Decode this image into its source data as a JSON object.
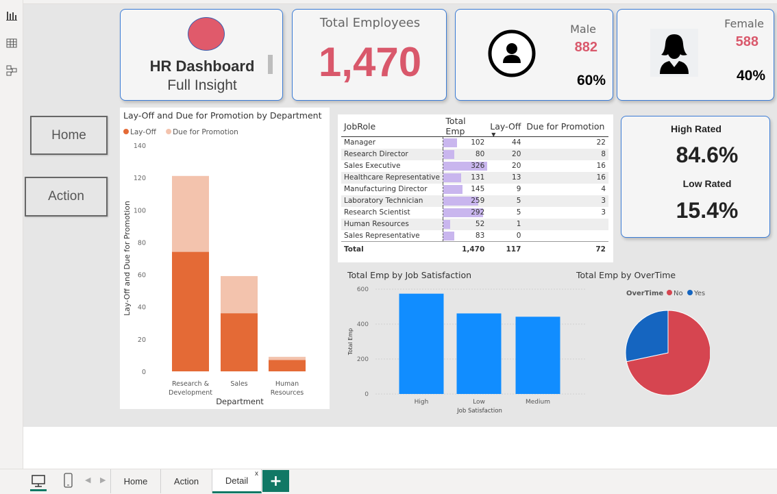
{
  "leftrail": {
    "icons": [
      "report-view-icon",
      "table-view-icon",
      "model-view-icon"
    ]
  },
  "nav": {
    "home_label": "Home",
    "action_label": "Action"
  },
  "title_card": {
    "title": "HR Dashboard",
    "subtitle": "Full Insight",
    "logo_color": "#e05a6b"
  },
  "total_card": {
    "label": "Total Employees",
    "value": "1,470"
  },
  "male_card": {
    "label": "Male",
    "count": "882",
    "percent": "60%",
    "icon": "person-circle-icon"
  },
  "female_card": {
    "label": "Female",
    "count": "588",
    "percent": "40%",
    "icon": "female-user-icon"
  },
  "rating_card": {
    "high_label": "High Rated",
    "high_value": "84.6%",
    "low_label": "Low Rated",
    "low_value": "15.4%"
  },
  "colors": {
    "accent_red": "#d9586b",
    "layoff": "#e46a36",
    "promotion": "#f3c3ad",
    "blue_bar": "#118dff",
    "pie_no": "#d64550",
    "pie_yes": "#1565c0",
    "table_bar": "#c9b6ee"
  },
  "jobrole_table": {
    "headers": [
      "JobRole",
      "Total Emp",
      "Lay-Off",
      "Due for Promotion"
    ],
    "rows": [
      {
        "role": "Manager",
        "total": "102",
        "layoff": "44",
        "promo": "22"
      },
      {
        "role": "Research Director",
        "total": "80",
        "layoff": "20",
        "promo": "8"
      },
      {
        "role": "Sales Executive",
        "total": "326",
        "layoff": "20",
        "promo": "16"
      },
      {
        "role": "Healthcare Representative",
        "total": "131",
        "layoff": "13",
        "promo": "16"
      },
      {
        "role": "Manufacturing Director",
        "total": "145",
        "layoff": "9",
        "promo": "4"
      },
      {
        "role": "Laboratory Technician",
        "total": "259",
        "layoff": "5",
        "promo": "3"
      },
      {
        "role": "Research Scientist",
        "total": "292",
        "layoff": "5",
        "promo": "3"
      },
      {
        "role": "Human Resources",
        "total": "52",
        "layoff": "1",
        "promo": ""
      },
      {
        "role": "Sales Representative",
        "total": "83",
        "layoff": "0",
        "promo": ""
      }
    ],
    "total": {
      "label": "Total",
      "total": "1,470",
      "layoff": "117",
      "promo": "72"
    },
    "bar_max": 326
  },
  "chart_data": [
    {
      "type": "bar",
      "stacked": true,
      "title": "Lay-Off and Due for Promotion by Department",
      "xlabel": "Department",
      "ylabel": "Lay-Off and Due for Promotion",
      "categories": [
        "Research & Development",
        "Sales",
        "Human Resources"
      ],
      "category_lines": [
        [
          "Research &",
          "Development"
        ],
        [
          "Sales"
        ],
        [
          "Human",
          "Resources"
        ]
      ],
      "series": [
        {
          "name": "Lay-Off",
          "values": [
            74,
            36,
            7
          ]
        },
        {
          "name": "Due for Promotion",
          "values": [
            47,
            23,
            2
          ]
        }
      ],
      "ylim": [
        0,
        140
      ],
      "yticks": [
        0,
        20,
        40,
        60,
        80,
        100,
        120,
        140
      ],
      "legend": "top-left",
      "grid": false
    },
    {
      "type": "bar",
      "title": "Total Emp by Job Satisfaction",
      "xlabel": "Job Satisfaction",
      "ylabel": "Total Emp",
      "categories": [
        "High",
        "Low",
        "Medium"
      ],
      "values": [
        574,
        461,
        442
      ],
      "ylim": [
        0,
        600
      ],
      "yticks": [
        0,
        200,
        400,
        600
      ],
      "grid": true
    },
    {
      "type": "pie",
      "title": "Total Emp by OverTime",
      "legend_title": "OverTime",
      "labels": [
        "No",
        "Yes"
      ],
      "values": [
        1054,
        416
      ],
      "legend": "top"
    }
  ],
  "pages": {
    "tabs": [
      "Home",
      "Action",
      "Detail"
    ],
    "active": "Detail",
    "close_glyph": "x",
    "add_glyph": "+"
  }
}
